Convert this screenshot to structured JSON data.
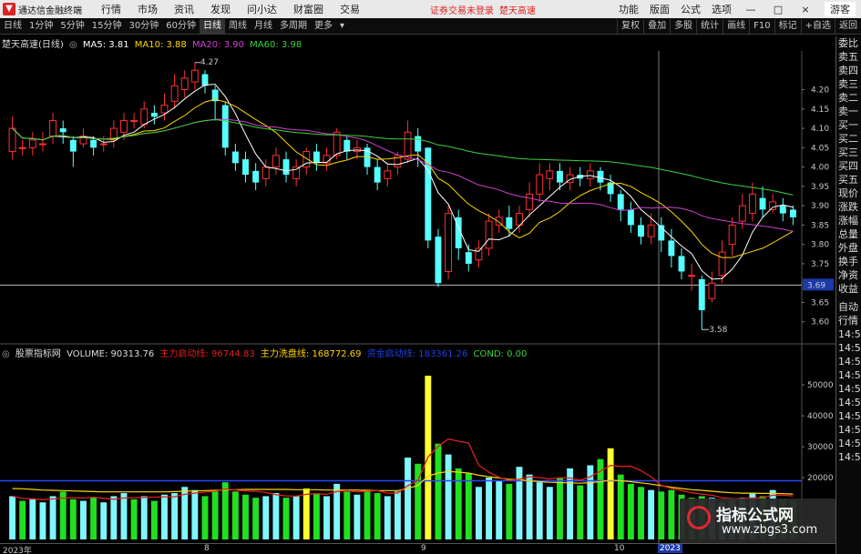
{
  "topbar": {
    "app_name": "通达信金融终端",
    "menus": [
      "行情",
      "市场",
      "资讯",
      "发现",
      "问小达",
      "财富圈",
      "交易"
    ],
    "alert_login": "证券交易未登录",
    "alert_stock": "楚天高速",
    "right_menus": [
      "功能",
      "版面",
      "公式",
      "选项"
    ],
    "win_min": "—",
    "win_max": "□",
    "win_close": "×",
    "guest": "游客"
  },
  "toolbar": {
    "left": [
      "日线",
      "1分钟",
      "5分钟",
      "15分钟",
      "30分钟",
      "60分钟",
      "日线",
      "周线",
      "月线",
      "多周期",
      "更多"
    ],
    "active_index": 6,
    "right": [
      "复权",
      "叠加",
      "多股",
      "统计",
      "画线",
      "F10",
      "标记",
      "+自选",
      "返回"
    ]
  },
  "main_info": {
    "stock": "楚天高速(日线)",
    "ma5_label": "MA5: 3.81",
    "ma10_label": "MA10: 3.88",
    "ma20_label": "MA20: 3.90",
    "ma60_label": "MA60: 3.98",
    "colors": {
      "ma5": "#ffffff",
      "ma10": "#ffd700",
      "ma20": "#d040d0",
      "ma60": "#3cd23c"
    }
  },
  "vol_info": {
    "name": "股票指标网",
    "volume": "VOLUME: 90313.76",
    "start": "主力启动线: 96744.83",
    "wash": "主力洗盘线: 168772.69",
    "fund": "资金启动线: 183361.26",
    "cond": "COND: 0.00"
  },
  "side_panel": {
    "items": [
      "委比",
      "卖五",
      "卖四",
      "卖三",
      "卖二",
      "卖一",
      "买一",
      "买二",
      "买三",
      "买四",
      "买五",
      "现价",
      "涨跌",
      "涨幅",
      "总量",
      "外盘",
      "换手",
      "净资",
      "收益"
    ],
    "lower": [
      "自动",
      "行情",
      "14:5",
      "14:5",
      "14:5",
      "14:5",
      "14:5",
      "14:5",
      "14:5",
      "14:5",
      "14:5",
      "14:5"
    ]
  },
  "price_axis": {
    "ticks": [
      "4.20",
      "4.15",
      "4.10",
      "4.05",
      "4.00",
      "3.95",
      "3.90",
      "3.85",
      "3.80",
      "3.75",
      "3.70",
      "3.65",
      "3.60"
    ],
    "current": "3.69"
  },
  "volume_axis": {
    "ticks": [
      "50000",
      "40000",
      "30000",
      "20000"
    ]
  },
  "annotations": {
    "high": "4.27",
    "low": "3.58"
  },
  "dates": {
    "d1": "2023年",
    "d2": "8",
    "d3": "9",
    "d4": "10",
    "d5": "2023"
  },
  "watermark": {
    "line1": "指标公式网",
    "line2": "www.zbgs3.com"
  },
  "chart_data": {
    "type": "candlestick",
    "ylim": [
      3.55,
      4.3
    ],
    "candles": [
      [
        4.04,
        4.1,
        4.13,
        4.02
      ],
      [
        4.05,
        4.05,
        4.07,
        4.03
      ],
      [
        4.05,
        4.07,
        4.09,
        4.03
      ],
      [
        4.06,
        4.06,
        4.09,
        4.04
      ],
      [
        4.08,
        4.12,
        4.14,
        4.06
      ],
      [
        4.1,
        4.09,
        4.12,
        4.06
      ],
      [
        4.07,
        4.04,
        4.08,
        4.0
      ],
      [
        4.06,
        4.08,
        4.1,
        4.05
      ],
      [
        4.07,
        4.05,
        4.08,
        4.03
      ],
      [
        4.06,
        4.06,
        4.08,
        4.04
      ],
      [
        4.07,
        4.1,
        4.12,
        4.05
      ],
      [
        4.09,
        4.12,
        4.14,
        4.07
      ],
      [
        4.12,
        4.12,
        4.14,
        4.1
      ],
      [
        4.11,
        4.15,
        4.17,
        4.1
      ],
      [
        4.14,
        4.13,
        4.16,
        4.11
      ],
      [
        4.14,
        4.16,
        4.19,
        4.12
      ],
      [
        4.17,
        4.21,
        4.24,
        4.15
      ],
      [
        4.2,
        4.23,
        4.25,
        4.18
      ],
      [
        4.22,
        4.25,
        4.27,
        4.2
      ],
      [
        4.24,
        4.21,
        4.25,
        4.19
      ],
      [
        4.2,
        4.17,
        4.21,
        4.12
      ],
      [
        4.16,
        4.05,
        4.17,
        4.03
      ],
      [
        4.04,
        4.01,
        4.06,
        3.99
      ],
      [
        4.02,
        3.98,
        4.04,
        3.96
      ],
      [
        3.99,
        3.96,
        4.01,
        3.94
      ],
      [
        3.97,
        4.0,
        4.02,
        3.95
      ],
      [
        4.0,
        4.03,
        4.05,
        3.98
      ],
      [
        4.02,
        3.98,
        4.04,
        3.96
      ],
      [
        3.97,
        4.0,
        4.02,
        3.95
      ],
      [
        4.0,
        4.04,
        4.05,
        3.98
      ],
      [
        4.04,
        4.01,
        4.06,
        3.99
      ],
      [
        4.01,
        4.03,
        4.05,
        3.99
      ],
      [
        4.03,
        4.09,
        4.1,
        4.02
      ],
      [
        4.07,
        4.04,
        4.08,
        4.02
      ],
      [
        4.04,
        4.05,
        4.07,
        4.02
      ],
      [
        4.05,
        4.0,
        4.06,
        3.98
      ],
      [
        4.0,
        3.96,
        4.02,
        3.94
      ],
      [
        3.97,
        3.99,
        4.01,
        3.95
      ],
      [
        4.0,
        4.03,
        4.04,
        3.98
      ],
      [
        4.02,
        4.09,
        4.12,
        4.01
      ],
      [
        4.08,
        4.04,
        4.1,
        4.0
      ],
      [
        4.05,
        3.81,
        4.05,
        3.79
      ],
      [
        3.82,
        3.7,
        3.84,
        3.69
      ],
      [
        3.73,
        3.88,
        3.9,
        3.71
      ],
      [
        3.87,
        3.79,
        3.89,
        3.76
      ],
      [
        3.78,
        3.75,
        3.8,
        3.73
      ],
      [
        3.76,
        3.79,
        3.81,
        3.74
      ],
      [
        3.79,
        3.86,
        3.88,
        3.77
      ],
      [
        3.85,
        3.87,
        3.89,
        3.83
      ],
      [
        3.87,
        3.84,
        3.9,
        3.82
      ],
      [
        3.85,
        3.88,
        3.9,
        3.83
      ],
      [
        3.89,
        3.93,
        3.96,
        3.87
      ],
      [
        3.93,
        3.98,
        4.01,
        3.91
      ],
      [
        3.97,
        3.99,
        4.01,
        3.94
      ],
      [
        3.99,
        3.96,
        4.01,
        3.94
      ],
      [
        3.96,
        3.98,
        4.0,
        3.94
      ],
      [
        3.98,
        3.97,
        4.0,
        3.95
      ],
      [
        3.97,
        3.99,
        4.01,
        3.95
      ],
      [
        3.99,
        3.96,
        4.0,
        3.94
      ],
      [
        3.96,
        3.93,
        3.98,
        3.91
      ],
      [
        3.93,
        3.89,
        3.94,
        3.86
      ],
      [
        3.89,
        3.85,
        3.91,
        3.83
      ],
      [
        3.85,
        3.82,
        3.87,
        3.8
      ],
      [
        3.82,
        3.85,
        3.88,
        3.8
      ],
      [
        3.85,
        3.81,
        3.87,
        3.78
      ],
      [
        3.81,
        3.77,
        3.84,
        3.74
      ],
      [
        3.77,
        3.73,
        3.79,
        3.71
      ],
      [
        3.72,
        3.72,
        3.75,
        3.68
      ],
      [
        3.71,
        3.63,
        3.72,
        3.58
      ],
      [
        3.66,
        3.7,
        3.73,
        3.65
      ],
      [
        3.72,
        3.78,
        3.81,
        3.7
      ],
      [
        3.8,
        3.85,
        3.87,
        3.77
      ],
      [
        3.86,
        3.9,
        3.93,
        3.84
      ],
      [
        3.88,
        3.93,
        3.96,
        3.86
      ],
      [
        3.92,
        3.89,
        3.95,
        3.87
      ],
      [
        3.89,
        3.91,
        3.93,
        3.88
      ],
      [
        3.9,
        3.88,
        3.92,
        3.86
      ],
      [
        3.89,
        3.87,
        3.9,
        3.85
      ]
    ],
    "volumes": [
      14000,
      12500,
      13000,
      12000,
      14000,
      15500,
      13000,
      12500,
      13500,
      12000,
      14000,
      15000,
      13000,
      14000,
      12500,
      14500,
      15000,
      17000,
      16000,
      14000,
      16000,
      18500,
      15500,
      14500,
      13500,
      14000,
      15000,
      13500,
      14000,
      16500,
      15000,
      14000,
      18000,
      15500,
      14500,
      16000,
      15000,
      14000,
      15500,
      26500,
      24500,
      53000,
      31000,
      27500,
      23000,
      21500,
      17000,
      20000,
      19000,
      18000,
      23500,
      21000,
      18500,
      17000,
      20000,
      23000,
      17500,
      24000,
      26000,
      29500,
      21000,
      18000,
      17000,
      16000,
      15500,
      16000,
      14500,
      13500,
      14000,
      13500,
      12000,
      13000,
      13500,
      15000,
      14000,
      16000,
      13000,
      12500
    ],
    "volume_up": [
      true,
      false,
      true,
      true,
      true,
      false,
      false,
      true,
      false,
      true,
      true,
      true,
      false,
      true,
      false,
      true,
      true,
      true,
      true,
      false,
      false,
      false,
      false,
      false,
      false,
      true,
      true,
      false,
      true,
      true,
      false,
      true,
      true,
      false,
      true,
      false,
      false,
      true,
      true,
      true,
      false,
      false,
      false,
      true,
      false,
      false,
      true,
      true,
      true,
      false,
      true,
      true,
      true,
      true,
      false,
      true,
      false,
      true,
      false,
      false,
      false,
      false,
      false,
      true,
      false,
      false,
      false,
      false,
      false,
      true,
      true,
      true,
      true,
      true,
      false,
      true,
      false,
      false
    ],
    "volume_highlight": {
      "41": "#ffff30",
      "29": "#ffff30",
      "59": "#ffff30"
    },
    "vol_ylim": [
      0,
      58000
    ],
    "fund_line": 19000,
    "wash_line": [
      16500,
      16400,
      16200,
      16000,
      15900,
      15800,
      15700,
      15600,
      15500,
      15400,
      15400,
      15400,
      15400,
      15400,
      15400,
      15400,
      15500,
      15600,
      15700,
      15800,
      15900,
      16000,
      16100,
      16200,
      16200,
      16200,
      16200,
      16200,
      16100,
      16100,
      16100,
      16000,
      16000,
      16000,
      16000,
      15900,
      15800,
      15800,
      15800,
      16500,
      17500,
      20500,
      21500,
      22000,
      21800,
      21500,
      20800,
      20300,
      19900,
      19500,
      19300,
      19000,
      18700,
      18500,
      18400,
      18300,
      18200,
      18400,
      18700,
      19200,
      19000,
      18700,
      18300,
      17900,
      17400,
      16900,
      16500,
      16100,
      15900,
      15600,
      15300,
      15100,
      15000,
      15000,
      14900,
      14900,
      14800,
      14700
    ]
  }
}
